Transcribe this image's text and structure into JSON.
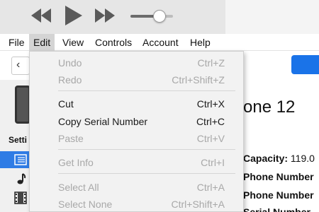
{
  "toolbar": {
    "icons": [
      "rewind-icon",
      "play-icon",
      "fast-forward-icon",
      "volume-slider"
    ],
    "volume_level": 0.75
  },
  "menubar": {
    "items": [
      "File",
      "Edit",
      "View",
      "Controls",
      "Account",
      "Help"
    ],
    "active": "Edit"
  },
  "edit_menu": {
    "items": [
      {
        "label": "Undo",
        "shortcut": "Ctrl+Z",
        "enabled": false
      },
      {
        "label": "Redo",
        "shortcut": "Ctrl+Shift+Z",
        "enabled": false
      },
      {
        "label": "Cut",
        "shortcut": "Ctrl+X",
        "enabled": true
      },
      {
        "label": "Copy Serial Number",
        "shortcut": "Ctrl+C",
        "enabled": true
      },
      {
        "label": "Paste",
        "shortcut": "Ctrl+V",
        "enabled": false
      },
      {
        "label": "Get Info",
        "shortcut": "Ctrl+I",
        "enabled": false
      },
      {
        "label": "Select All",
        "shortcut": "Ctrl+A",
        "enabled": false
      },
      {
        "label": "Select None",
        "shortcut": "Ctrl+Shift+A",
        "enabled": false
      }
    ]
  },
  "sidebar": {
    "settings_label": "Setti",
    "icons": [
      "list-icon",
      "music-note-icon",
      "film-icon"
    ]
  },
  "device": {
    "title": "one 12",
    "capacity_label": "Capacity:",
    "capacity_value": "119.0",
    "phone_number_label_1": "Phone Number",
    "phone_number_label_2": "Phone Number",
    "serial_label": "Serial Number"
  },
  "colors": {
    "accent": "#2f7ce5",
    "primary_button": "#1a73e8",
    "disabled_text": "#a8a8a8"
  }
}
